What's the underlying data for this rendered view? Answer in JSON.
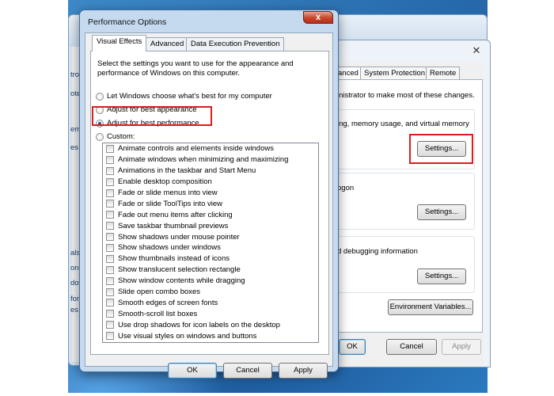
{
  "background_window": {
    "left_strip": [
      "trol",
      "ote",
      "em",
      "es",
      "alsc",
      "on",
      "dow",
      "form",
      "es"
    ]
  },
  "system_properties": {
    "close_glyph": "✕",
    "tabs": [
      "anced",
      "System Protection",
      "Remote"
    ],
    "admin_text": "inistrator to make most of these changes.",
    "performance_text": "ing, memory usage, and virtual memory",
    "performance_settings": "Settings...",
    "profiles_text": "ogon",
    "profiles_settings": "Settings...",
    "startup_text": "d debugging information",
    "startup_settings": "Settings...",
    "env_button": "Environment Variables...",
    "ok": "OK",
    "cancel": "Cancel",
    "apply": "Apply"
  },
  "performance_options": {
    "title": "Performance Options",
    "close_glyph": "x",
    "tabs": [
      "Visual Effects",
      "Advanced",
      "Data Execution Prevention"
    ],
    "description": "Select the settings you want to use for the appearance and performance of Windows on this computer.",
    "radios": [
      {
        "label": "Let Windows choose what's best for my computer",
        "checked": false
      },
      {
        "label": "Adjust for best appearance",
        "checked": false
      },
      {
        "label": "Adjust for best performance",
        "checked": true
      },
      {
        "label": "Custom:",
        "checked": false
      }
    ],
    "effects": [
      "Animate controls and elements inside windows",
      "Animate windows when minimizing and maximizing",
      "Animations in the taskbar and Start Menu",
      "Enable desktop composition",
      "Fade or slide menus into view",
      "Fade or slide ToolTips into view",
      "Fade out menu items after clicking",
      "Save taskbar thumbnail previews",
      "Show shadows under mouse pointer",
      "Show shadows under windows",
      "Show thumbnails instead of icons",
      "Show translucent selection rectangle",
      "Show window contents while dragging",
      "Slide open combo boxes",
      "Smooth edges of screen fonts",
      "Smooth-scroll list boxes",
      "Use drop shadows for icon labels on the desktop",
      "Use visual styles on windows and buttons"
    ],
    "ok": "OK",
    "cancel": "Cancel",
    "apply": "Apply"
  },
  "colors": {
    "highlight": "#d81e1e",
    "desktop": "#2a6fb0"
  }
}
